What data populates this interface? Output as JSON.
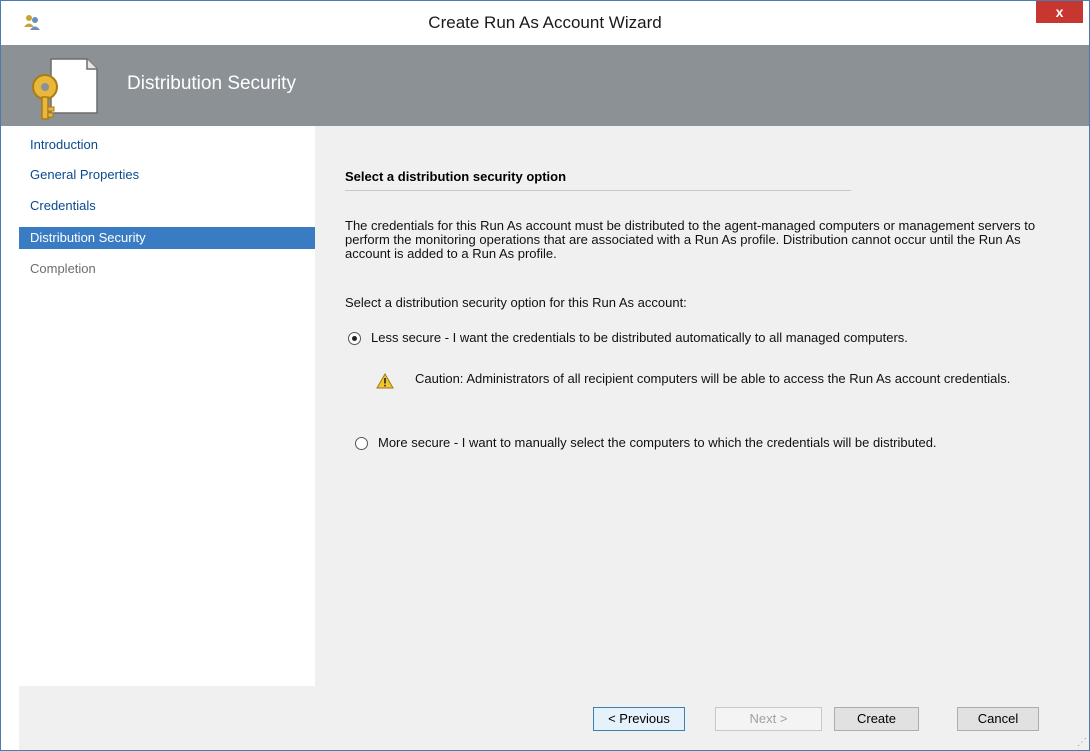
{
  "window": {
    "title": "Create Run As Account Wizard",
    "close_label": "x"
  },
  "header": {
    "title": "Distribution Security"
  },
  "nav": {
    "items": [
      {
        "label": "Introduction",
        "state": "normal"
      },
      {
        "label": "General Properties",
        "state": "normal"
      },
      {
        "label": "Credentials",
        "state": "normal"
      },
      {
        "label": "Distribution Security",
        "state": "active"
      },
      {
        "label": "Completion",
        "state": "disabled"
      }
    ]
  },
  "content": {
    "section_title": "Select a distribution security option",
    "description": "The credentials for this Run As account must be distributed to the agent-managed computers or management servers to perform the monitoring operations that are associated with a Run As profile. Distribution cannot occur until the Run As account is added to a Run As profile.",
    "prompt": "Select a distribution security option for this Run As account:",
    "options": [
      {
        "label": "Less secure - I want the credentials to be distributed automatically to all managed computers.",
        "selected": true
      },
      {
        "label": "More secure - I want to manually select the computers to which the credentials will be distributed.",
        "selected": false
      }
    ],
    "caution": "Caution: Administrators of all recipient computers will be able to access the Run As account credentials."
  },
  "footer": {
    "previous_label": "< Previous",
    "next_label": "Next >",
    "create_label": "Create",
    "cancel_label": "Cancel"
  },
  "colors": {
    "header_bg": "#8c9195",
    "nav_active": "#3a7cc4",
    "close_button": "#c7372f"
  },
  "icons": [
    "run-as-account-icon",
    "key-document-icon",
    "warning-icon",
    "resize-grip-icon"
  ]
}
